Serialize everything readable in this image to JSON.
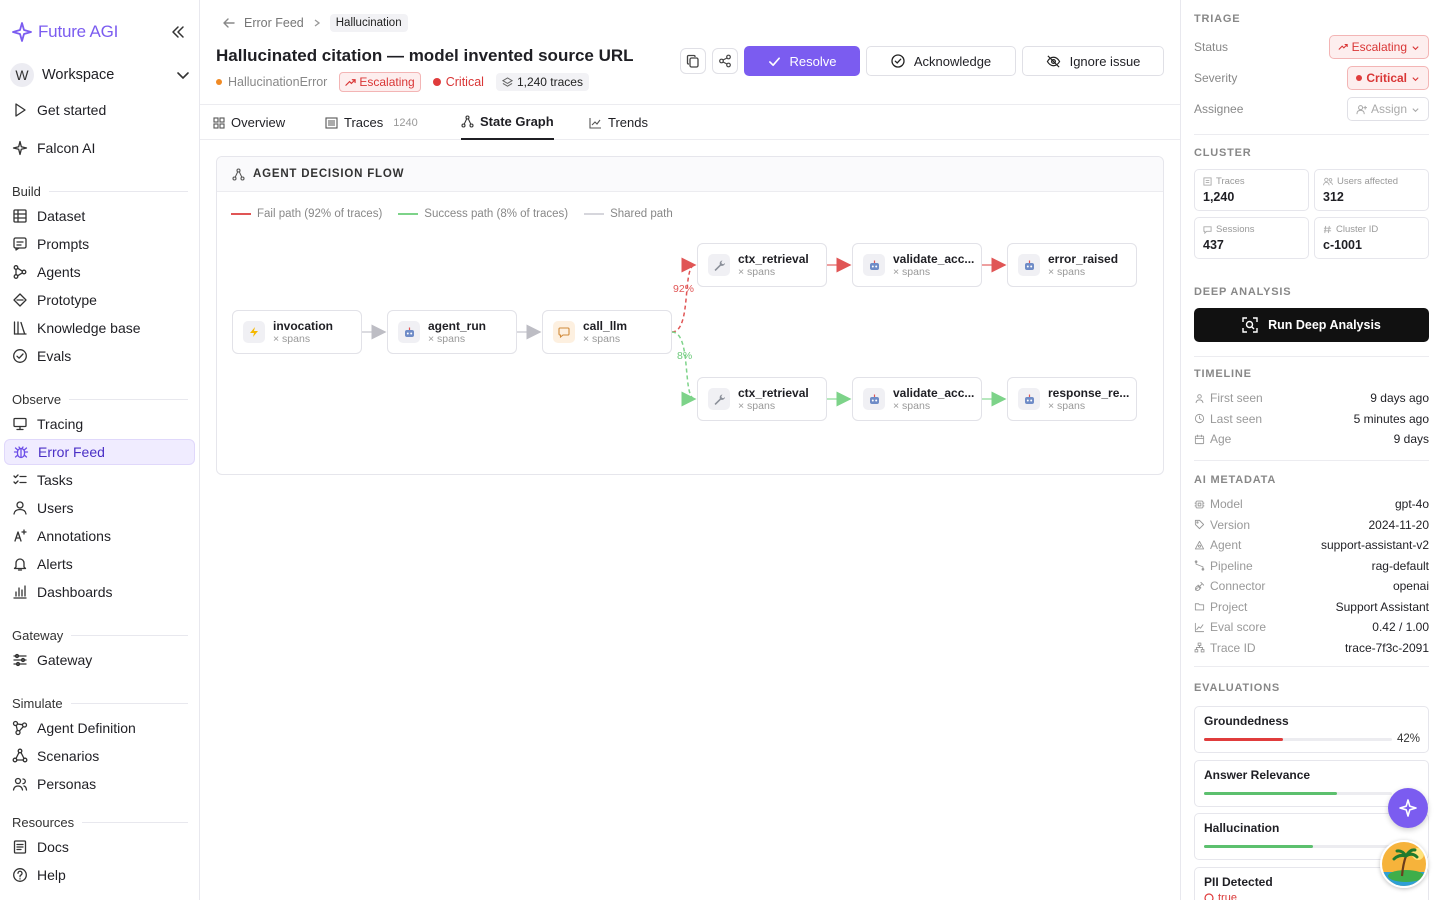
{
  "app": {
    "brand": "Future AGI",
    "workspace_initial": "W",
    "workspace": "Workspace",
    "accent": "#7b5cf0"
  },
  "sidebar": {
    "top": [
      {
        "id": "get-started",
        "label": "Get started",
        "icon": "play-icon"
      },
      {
        "id": "falcon-ai",
        "label": "Falcon AI",
        "icon": "sparkle-icon"
      }
    ],
    "sections": [
      {
        "title": "Build",
        "items": [
          {
            "id": "dataset",
            "label": "Dataset",
            "icon": "grid-icon"
          },
          {
            "id": "prompts",
            "label": "Prompts",
            "icon": "chat-icon"
          },
          {
            "id": "agents",
            "label": "Agents",
            "icon": "agents-icon"
          },
          {
            "id": "prototype",
            "label": "Prototype",
            "icon": "prototype-icon"
          },
          {
            "id": "knowledge-base",
            "label": "Knowledge base",
            "icon": "books-icon"
          },
          {
            "id": "evals",
            "label": "Evals",
            "icon": "check-circle-icon"
          }
        ]
      },
      {
        "title": "Observe",
        "items": [
          {
            "id": "tracing",
            "label": "Tracing",
            "icon": "monitor-icon"
          },
          {
            "id": "error-feed",
            "label": "Error Feed",
            "icon": "bug-icon",
            "active": true
          },
          {
            "id": "tasks",
            "label": "Tasks",
            "icon": "tasks-icon"
          },
          {
            "id": "users",
            "label": "Users",
            "icon": "user-icon"
          },
          {
            "id": "annotations",
            "label": "Annotations",
            "icon": "annotate-icon"
          },
          {
            "id": "alerts",
            "label": "Alerts",
            "icon": "bell-icon"
          },
          {
            "id": "dashboards",
            "label": "Dashboards",
            "icon": "bar-chart-icon"
          }
        ]
      },
      {
        "title": "Gateway",
        "items": [
          {
            "id": "gateway",
            "label": "Gateway",
            "icon": "gateway-icon"
          }
        ]
      },
      {
        "title": "Simulate",
        "items": [
          {
            "id": "agent-definition",
            "label": "Agent Definition",
            "icon": "nodes-icon"
          },
          {
            "id": "scenarios",
            "label": "Scenarios",
            "icon": "scenario-icon"
          },
          {
            "id": "personas",
            "label": "Personas",
            "icon": "people-icon"
          }
        ]
      },
      {
        "title": "Resources",
        "items": [
          {
            "id": "docs",
            "label": "Docs",
            "icon": "doc-icon"
          },
          {
            "id": "help",
            "label": "Help",
            "icon": "help-icon"
          }
        ]
      }
    ]
  },
  "header": {
    "breadcrumb_parent": "Error Feed",
    "breadcrumb_current": "Hallucination",
    "title": "Hallucinated citation — model invented source URL",
    "error_type": "HallucinationError",
    "status_badge": "Escalating",
    "severity": "Critical",
    "traces": "1,240 traces",
    "resolve_label": "Resolve",
    "acknowledge_label": "Acknowledge",
    "ignore_label": "Ignore issue"
  },
  "tabs": [
    {
      "id": "overview",
      "label": "Overview",
      "icon": "grid-icon"
    },
    {
      "id": "traces",
      "label": "Traces",
      "count": "1240",
      "icon": "list-icon"
    },
    {
      "id": "state-graph",
      "label": "State Graph",
      "icon": "graph-icon",
      "active": true
    },
    {
      "id": "trends",
      "label": "Trends",
      "icon": "trend-icon"
    }
  ],
  "flow": {
    "title": "AGENT DECISION FLOW",
    "legend": {
      "fail": "Fail path (92% of traces)",
      "success": "Success path (8% of traces)",
      "shared": "Shared path"
    },
    "colors": {
      "fail": "#e05555",
      "success": "#7dd389",
      "shared": "#cfcfd6"
    },
    "fail_pct": "92%",
    "success_pct": "8%",
    "nodes": [
      {
        "id": "invocation",
        "name": "invocation",
        "sub": "× spans",
        "icon": "lightning-icon"
      },
      {
        "id": "agent_run",
        "name": "agent_run",
        "sub": "× spans",
        "icon": "robot-icon"
      },
      {
        "id": "call_llm",
        "name": "call_llm",
        "sub": "× spans",
        "icon": "chat-bubble-icon"
      },
      {
        "id": "ctx_retrieval_fail",
        "name": "ctx_retrieval",
        "sub": "× spans",
        "icon": "wrench-icon"
      },
      {
        "id": "validate_fail",
        "name": "validate_acc...",
        "sub": "× spans",
        "icon": "robot-icon"
      },
      {
        "id": "error_raised",
        "name": "error_raised",
        "sub": "× spans",
        "icon": "robot-icon"
      },
      {
        "id": "ctx_retrieval_ok",
        "name": "ctx_retrieval",
        "sub": "× spans",
        "icon": "wrench-icon"
      },
      {
        "id": "validate_ok",
        "name": "validate_acc...",
        "sub": "× spans",
        "icon": "robot-icon"
      },
      {
        "id": "response_re",
        "name": "response_re...",
        "sub": "× spans",
        "icon": "robot-icon"
      }
    ]
  },
  "panel": {
    "triage": {
      "title": "TRIAGE",
      "status_label": "Status",
      "status": "Escalating",
      "severity_label": "Severity",
      "severity": "Critical",
      "assignee_label": "Assignee",
      "assignee": "Assign"
    },
    "cluster": {
      "title": "CLUSTER",
      "stats": [
        {
          "label": "Traces",
          "value": "1,240",
          "icon": "traces-icon"
        },
        {
          "label": "Users affected",
          "value": "312",
          "icon": "users-icon"
        },
        {
          "label": "Sessions",
          "value": "437",
          "icon": "sessions-icon"
        },
        {
          "label": "Cluster ID",
          "value": "c-1001",
          "icon": "hash-icon"
        }
      ]
    },
    "deep": {
      "title": "DEEP ANALYSIS",
      "button": "Run Deep Analysis"
    },
    "timeline": {
      "title": "TIMELINE",
      "rows": [
        {
          "label": "First seen",
          "value": "9 days ago",
          "icon": "person-icon"
        },
        {
          "label": "Last seen",
          "value": "5 minutes ago",
          "icon": "clock-icon"
        },
        {
          "label": "Age",
          "value": "9 days",
          "icon": "calendar-icon"
        }
      ]
    },
    "metadata": {
      "title": "AI METADATA",
      "rows": [
        {
          "label": "Model",
          "value": "gpt-4o",
          "icon": "model-icon"
        },
        {
          "label": "Version",
          "value": "2024-11-20",
          "icon": "tag-icon"
        },
        {
          "label": "Agent",
          "value": "support-assistant-v2",
          "icon": "agent-icon"
        },
        {
          "label": "Pipeline",
          "value": "rag-default",
          "icon": "pipeline-icon"
        },
        {
          "label": "Connector",
          "value": "openai",
          "icon": "plug-icon"
        },
        {
          "label": "Project",
          "value": "Support Assistant",
          "icon": "folder-icon"
        },
        {
          "label": "Eval score",
          "value": "0.42 / 1.00",
          "icon": "chart-icon"
        },
        {
          "label": "Trace ID",
          "value": "trace-7f3c-2091",
          "icon": "tree-icon"
        }
      ]
    },
    "evaluations": {
      "title": "EVALUATIONS",
      "items": [
        {
          "name": "Groundedness",
          "pct": "42%",
          "fill": 0.42,
          "color": "#e03c3c"
        },
        {
          "name": "Answer Relevance",
          "pct": "",
          "fill": 0.71,
          "color": "#5cc06e"
        },
        {
          "name": "Hallucination",
          "pct": "",
          "fill": 0.58,
          "color": "#5cc06e"
        },
        {
          "name": "PII Detected",
          "value": "true",
          "color": "#e03c3c"
        }
      ]
    }
  }
}
